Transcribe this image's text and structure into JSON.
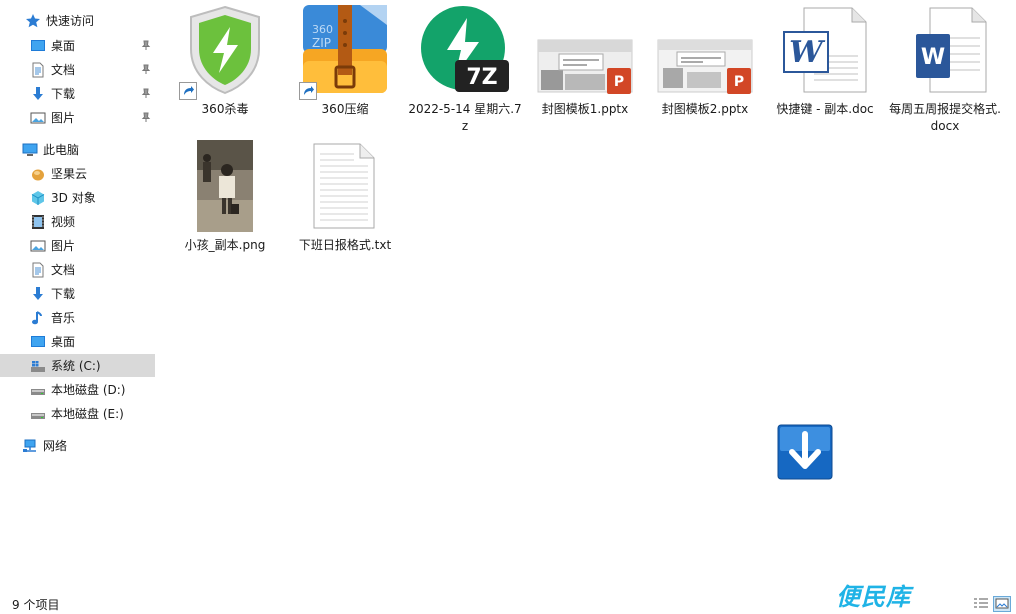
{
  "sidebar": {
    "quick_access": "快速访问",
    "quick_items": [
      "桌面",
      "文档",
      "下载",
      "图片"
    ],
    "this_pc": "此电脑",
    "pc_items": [
      "坚果云",
      "3D 对象",
      "视频",
      "图片",
      "文档",
      "下载",
      "音乐",
      "桌面",
      "系统 (C:)",
      "本地磁盘 (D:)",
      "本地磁盘 (E:)"
    ],
    "network": "网络"
  },
  "files": [
    {
      "name": "360杀毒",
      "icon": "shield-icon"
    },
    {
      "name": "360压缩",
      "icon": "zip-icon"
    },
    {
      "name": "2022-5-14 星期六.7z",
      "icon": "7z-icon"
    },
    {
      "name": "封图模板1.pptx",
      "icon": "pptx-icon"
    },
    {
      "name": "封图模板2.pptx",
      "icon": "pptx-icon"
    },
    {
      "name": "快捷键 - 副本.doc",
      "icon": "doc-icon"
    },
    {
      "name": "每周五周报提交格式.docx",
      "icon": "docx-icon"
    },
    {
      "name": "小孩_副本.png",
      "icon": "photo-icon"
    },
    {
      "name": "下班日报格式.txt",
      "icon": "txt-icon"
    }
  ],
  "status": {
    "item_count": "9 个项目"
  },
  "watermark": "便民库",
  "colors": {
    "selected": "#d9d9d9",
    "accent": "#1fb3e6",
    "shield_green": "#6cc13d",
    "word_blue": "#2b579a",
    "ppt_red": "#d24726"
  }
}
